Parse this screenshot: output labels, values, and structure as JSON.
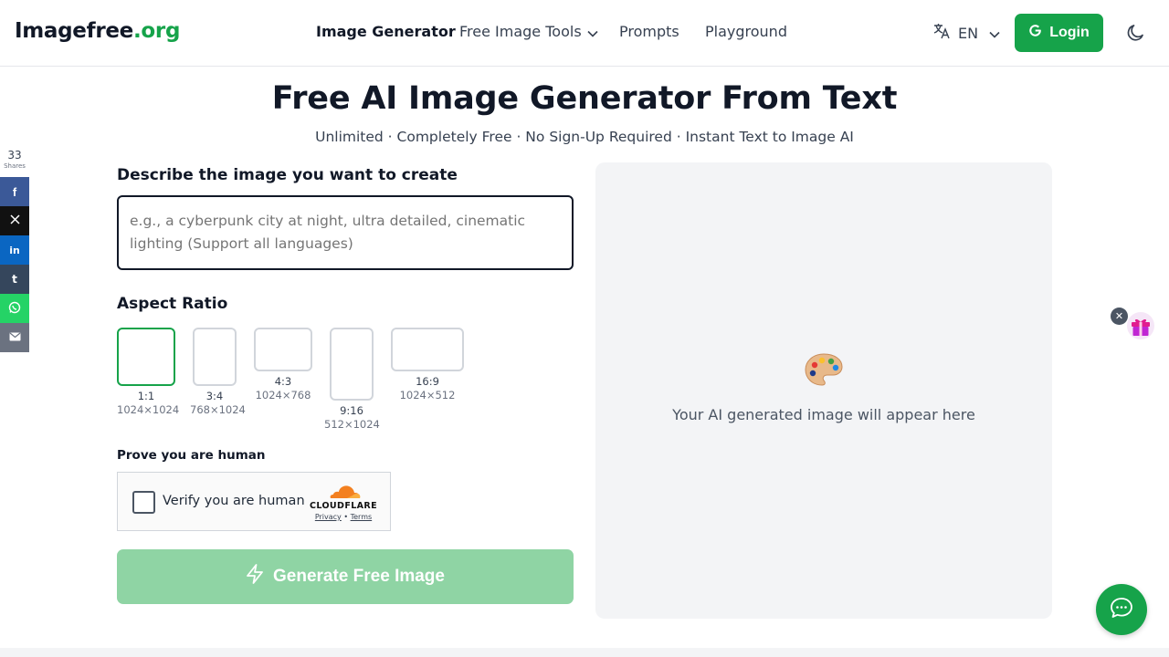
{
  "header": {
    "logo_main": "Imagefree",
    "logo_tld": ".org",
    "nav": {
      "image_generator": "Image Generator",
      "free_image_tools": "Free Image Tools",
      "prompts": "Prompts",
      "playground": "Playground"
    },
    "language": "EN",
    "login_label": "Login"
  },
  "hero": {
    "title": "Free AI Image Generator From Text",
    "subtitle": "Unlimited · Completely Free · No Sign-Up Required · Instant Text to Image AI"
  },
  "share": {
    "count": "33",
    "count_label": "Shares",
    "buttons": [
      {
        "name": "facebook",
        "color": "#3b5998",
        "glyph": "f"
      },
      {
        "name": "x",
        "color": "#111111",
        "glyph": "𝕏"
      },
      {
        "name": "linkedin",
        "color": "#0a66c2",
        "glyph": "in"
      },
      {
        "name": "tumblr",
        "color": "#35465c",
        "glyph": "t"
      },
      {
        "name": "whatsapp",
        "color": "#25d366",
        "glyph": "✆"
      },
      {
        "name": "email",
        "color": "#6b7280",
        "glyph": "✉"
      }
    ]
  },
  "form": {
    "prompt_label": "Describe the image you want to create",
    "prompt_placeholder": "e.g., a cyberpunk city at night, ultra detailed, cinematic lighting (Support all languages)",
    "prompt_value": "",
    "aspect_label": "Aspect Ratio",
    "ratios": [
      {
        "ratio": "1:1",
        "dims": "1024×1024",
        "selected": true
      },
      {
        "ratio": "3:4",
        "dims": "768×1024",
        "selected": false
      },
      {
        "ratio": "4:3",
        "dims": "1024×768",
        "selected": false
      },
      {
        "ratio": "9:16",
        "dims": "512×1024",
        "selected": false
      },
      {
        "ratio": "16:9",
        "dims": "1024×512",
        "selected": false
      }
    ],
    "human_label": "Prove you are human",
    "captcha_text": "Verify you are human",
    "captcha_brand": "CLOUDFLARE",
    "captcha_privacy": "Privacy",
    "captcha_sep": "•",
    "captcha_terms": "Terms",
    "generate_label": "Generate Free Image"
  },
  "preview": {
    "placeholder_text": "Your AI generated image will appear here"
  },
  "colors": {
    "brand_green": "#16a34a",
    "generate_disabled": "#8fd4a4",
    "preview_bg": "#f3f4f6"
  }
}
